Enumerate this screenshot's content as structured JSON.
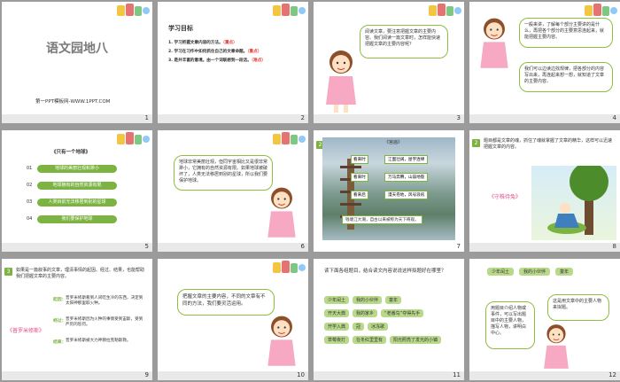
{
  "slides": [
    {
      "num": "1",
      "title": "语文园地八",
      "footer": "第一PPT模板网-WWW.1PPT.COM"
    },
    {
      "num": "2",
      "heading": "学习目标",
      "goals": [
        {
          "text": "1. 学习把握文章内容的方法。",
          "tag": "（重点）"
        },
        {
          "text": "2. 学习在习作中如何抓住自己的文章命题。",
          "tag": "（重点）"
        },
        {
          "text": "3. 是并丰富的意境。由一个词联想到一段话。",
          "tag": "（难点）"
        }
      ]
    },
    {
      "num": "3",
      "bubble": "阅读文章，要注意把握文章的主要内容。我们阅读一篇文章时，怎样能快速把握文章的主要内容呢？"
    },
    {
      "num": "4",
      "bubble1": "一般来讲，了解每个部分主要讲的是什么，再把各个部分的主要意思连起来，就能把握主要内容。",
      "bubble2": "我们可以边读边找规律，把各部分的内容写出来，再连起来想一想，就知道了文章的主要内容。"
    },
    {
      "num": "5",
      "title": "《只有一个地球》",
      "items": [
        {
          "no": "01",
          "text": "地球的美丽壮观和渺小"
        },
        {
          "no": "02",
          "text": "地球拥有的自然资源有限"
        },
        {
          "no": "03",
          "text": "人类目前无法移居到别的星球"
        },
        {
          "no": "04",
          "text": "我们要保护地球"
        }
      ]
    },
    {
      "num": "6",
      "bubble": "地球非常美丽壮观，但同宇宙相比又是很非常渺小，它拥有的自然资源有限。如果地球被破坏了，人类无法移居到别的星球，所以我们要保护地球。"
    },
    {
      "num": "7",
      "badge": "2",
      "title": "《宫庙》",
      "rows": [
        {
          "tag": "看来时",
          "text": "江面壮阔，屋宇连绵"
        },
        {
          "tag": "看来时",
          "text": "万马奔腾，山崩地裂"
        },
        {
          "tag": "看来后",
          "text": "漫天卷地，风号浪吼"
        }
      ],
      "bottom": "钱塘江大潮，自古以来被称为天下奇观。"
    },
    {
      "num": "8",
      "badge": "2",
      "text": "题目都是文章的魂，抓住了魂就掌握了文章的精华，这样可以迅速把握文章的内容。",
      "caption": "《守株待兔》"
    },
    {
      "num": "9",
      "badge": "3",
      "intro": "如果是一篇叙事的文章，理清事情的起因、经过、结果，也能帮助我们把握文章的主要内容。",
      "caption": "《普罗米修斯》",
      "steps": [
        {
          "tag": "起因：",
          "text": "普罗米修斯看到人间吃生冷的东西，决定到太阳神那里取火种。"
        },
        {
          "tag": "经过：",
          "text": "普罗米修斯因为火种的事情受到宙斯，受到严厉的惩罚。"
        },
        {
          "tag": "结果：",
          "text": "普罗米修斯被大力神赫拉克勒斯救。"
        }
      ]
    },
    {
      "num": "10",
      "bubble": "把握文章的主要内容，不同的文章有不同的方法，我们要灵活运用。"
    },
    {
      "num": "11",
      "question": "读下面各组题目，结合读文内容说说这样拟题好在哪里？",
      "rows": [
        [
          "少年闰土",
          "我的小伙伴",
          "童年"
        ],
        [
          "开天大典",
          "我的家乡",
          "“老番鸟”夺得先手"
        ],
        [
          "开学入典",
          "冠",
          "冰冻歌"
        ],
        [
          "草莓夜灯",
          "在冬红里里有",
          "阳光照亮了发光的小镇"
        ]
      ]
    },
    {
      "num": "12",
      "tags": [
        "少年闰土",
        "我的小伙伴",
        "童年"
      ],
      "bubble1": "用题目介绍人物或事件，可以写出题目中的主要人物，描写人物，讲明白中心。",
      "bubble2": "这是用文章中的主要人物来拟题。"
    }
  ],
  "colors": {
    "green": "#7cb342",
    "lightgreen": "#b9d98a",
    "pink": "#e0508a",
    "red": "#e53935",
    "orange": "#f08a00"
  }
}
